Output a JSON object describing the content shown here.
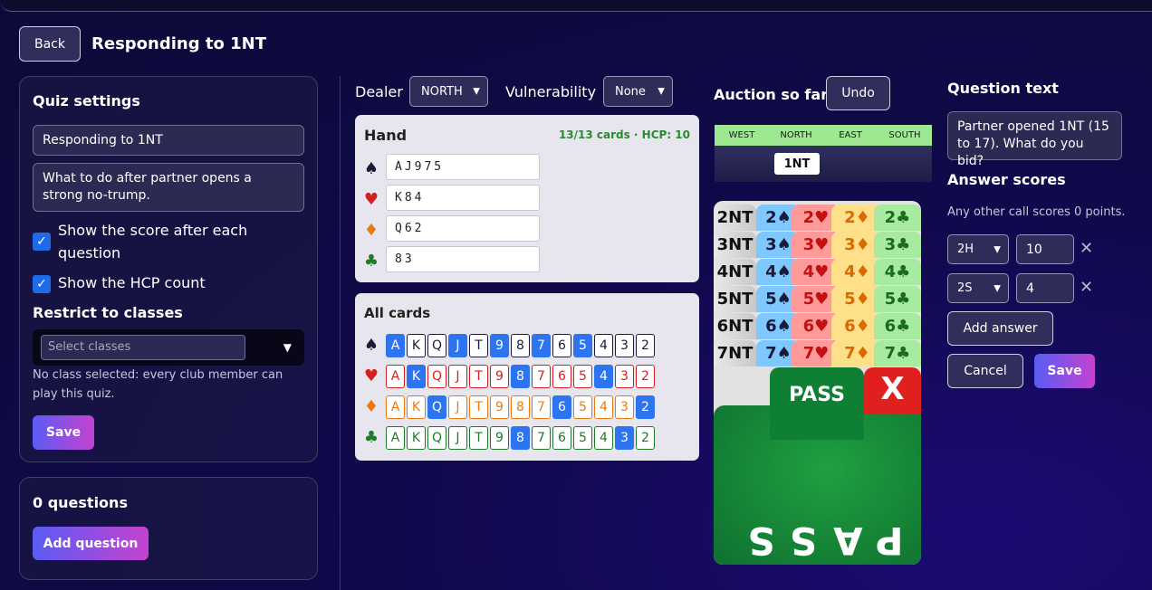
{
  "header": {
    "back_label": "Back",
    "title": "Responding to 1NT"
  },
  "settings": {
    "title": "Quiz settings",
    "name_value": "Responding to 1NT",
    "description_value": "What to do after partner opens a strong no-trump.",
    "show_score_label": "Show the score after each question",
    "show_hcp_label": "Show the HCP count",
    "restrict_title": "Restrict to classes",
    "classes_placeholder": "Select classes",
    "classes_note": "No class selected: every club member can play this quiz.",
    "save_label": "Save"
  },
  "questions": {
    "title": "0 questions",
    "add_label": "Add question"
  },
  "deal": {
    "dealer_label": "Dealer",
    "dealer_value": "NORTH",
    "vuln_label": "Vulnerability",
    "vuln_value": "None"
  },
  "hand": {
    "title": "Hand",
    "count": "13/13 cards · HCP: 10",
    "spades": "AJ975",
    "hearts": "K84",
    "diamonds": "Q62",
    "clubs": "83"
  },
  "all_cards": {
    "title": "All cards",
    "ranks": [
      "A",
      "K",
      "Q",
      "J",
      "T",
      "9",
      "8",
      "7",
      "6",
      "5",
      "4",
      "3",
      "2"
    ],
    "spades_selected": [
      0,
      3,
      5,
      7,
      9
    ],
    "hearts_selected": [
      1,
      6,
      10
    ],
    "diamonds_selected": [
      2,
      8,
      12
    ],
    "clubs_selected": [
      6,
      11
    ]
  },
  "suits": {
    "spade": "♠",
    "heart": "♥",
    "diamond": "♦",
    "club": "♣"
  },
  "colors": {
    "spade": "#1a1a3a",
    "heart": "#d42020",
    "diamond": "#ea7a10",
    "club": "#1f7a2a",
    "selected": "#2d75f0",
    "accent_green": "#2a8a30"
  },
  "auction": {
    "title": "Auction so far",
    "undo_label": "Undo",
    "columns": [
      "WEST",
      "NORTH",
      "EAST",
      "SOUTH"
    ],
    "bid": "1NT"
  },
  "bidding_box": {
    "rows": [
      [
        "2NT",
        "2♠",
        "2♥",
        "2♦",
        "2♣"
      ],
      [
        "3NT",
        "3♠",
        "3♥",
        "3♦",
        "3♣"
      ],
      [
        "4NT",
        "4♠",
        "4♥",
        "4♦",
        "4♣"
      ],
      [
        "5NT",
        "5♠",
        "5♥",
        "5♦",
        "5♣"
      ],
      [
        "6NT",
        "6♠",
        "6♥",
        "6♦",
        "6♣"
      ],
      [
        "7NT",
        "7♠",
        "7♥",
        "7♦",
        "7♣"
      ]
    ],
    "pass_label": "PASS",
    "double_label": "X",
    "pass_big": "PASS"
  },
  "question": {
    "title": "Question text",
    "text_value": "Partner opened 1NT (15 to 17). What do you bid?",
    "answers_title": "Answer scores",
    "answers_note": "Any other call scores 0 points.",
    "answers": [
      {
        "call": "2H",
        "score": "10"
      },
      {
        "call": "2S",
        "score": "4"
      }
    ],
    "add_answer_label": "Add answer",
    "cancel_label": "Cancel",
    "save_label": "Save"
  }
}
